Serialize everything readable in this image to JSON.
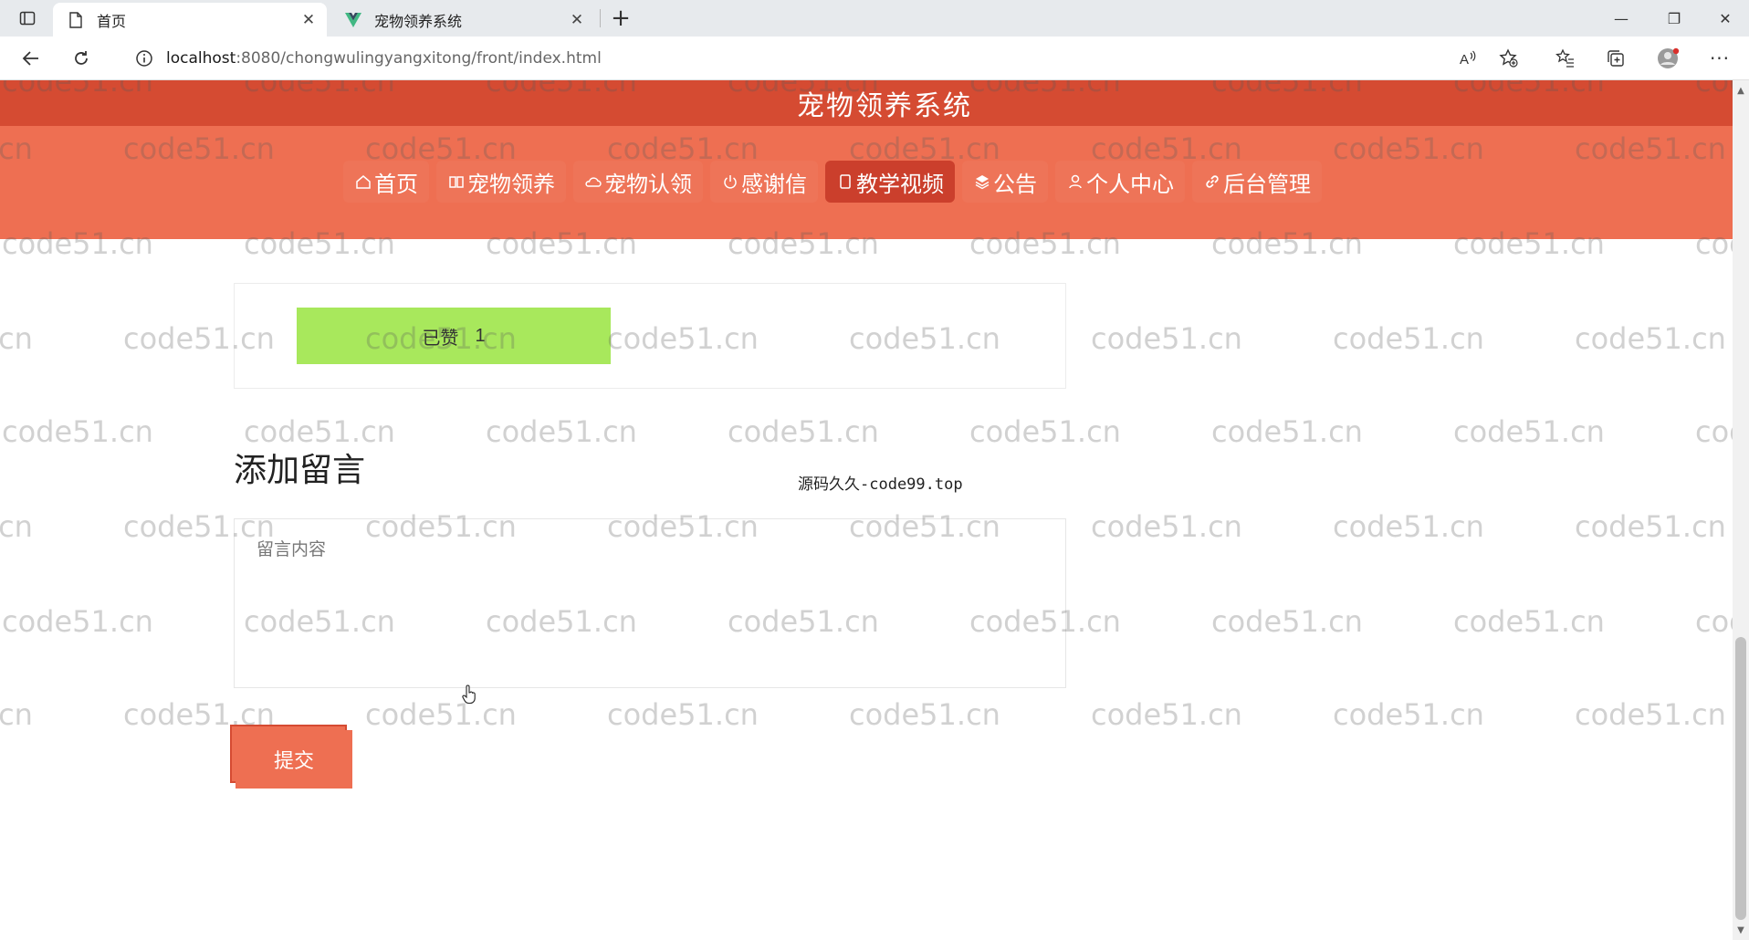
{
  "browser": {
    "tabs": [
      {
        "title": "首页",
        "active": true
      },
      {
        "title": "宠物领养系统",
        "active": false
      }
    ],
    "url_host": "localhost",
    "url_rest": ":8080/chongwulingyangxitong/front/index.html"
  },
  "header": {
    "site_title": "宠物领养系统",
    "nav": [
      {
        "label": "首页",
        "icon": "home-icon",
        "active": false
      },
      {
        "label": "宠物领养",
        "icon": "book-icon",
        "active": false
      },
      {
        "label": "宠物认领",
        "icon": "cloud-icon",
        "active": false
      },
      {
        "label": "感谢信",
        "icon": "power-icon",
        "active": false
      },
      {
        "label": "教学视频",
        "icon": "tablet-icon",
        "active": true
      },
      {
        "label": "公告",
        "icon": "layers-icon",
        "active": false
      },
      {
        "label": "个人中心",
        "icon": "user-icon",
        "active": false
      },
      {
        "label": "后台管理",
        "icon": "link-icon",
        "active": false
      }
    ]
  },
  "like": {
    "label": "已赞",
    "count": "1"
  },
  "comment": {
    "section_title": "添加留言",
    "source_note": "源码久久-code99.top",
    "placeholder": "留言内容",
    "submit_label": "提交"
  },
  "watermark_text": "code51.cn",
  "colors": {
    "title_bar": "#d54b32",
    "nav_bar": "#ee6f52",
    "nav_active": "#cb3f2c",
    "like_button": "#a8e85c",
    "submit_button": "#ee6f52"
  }
}
